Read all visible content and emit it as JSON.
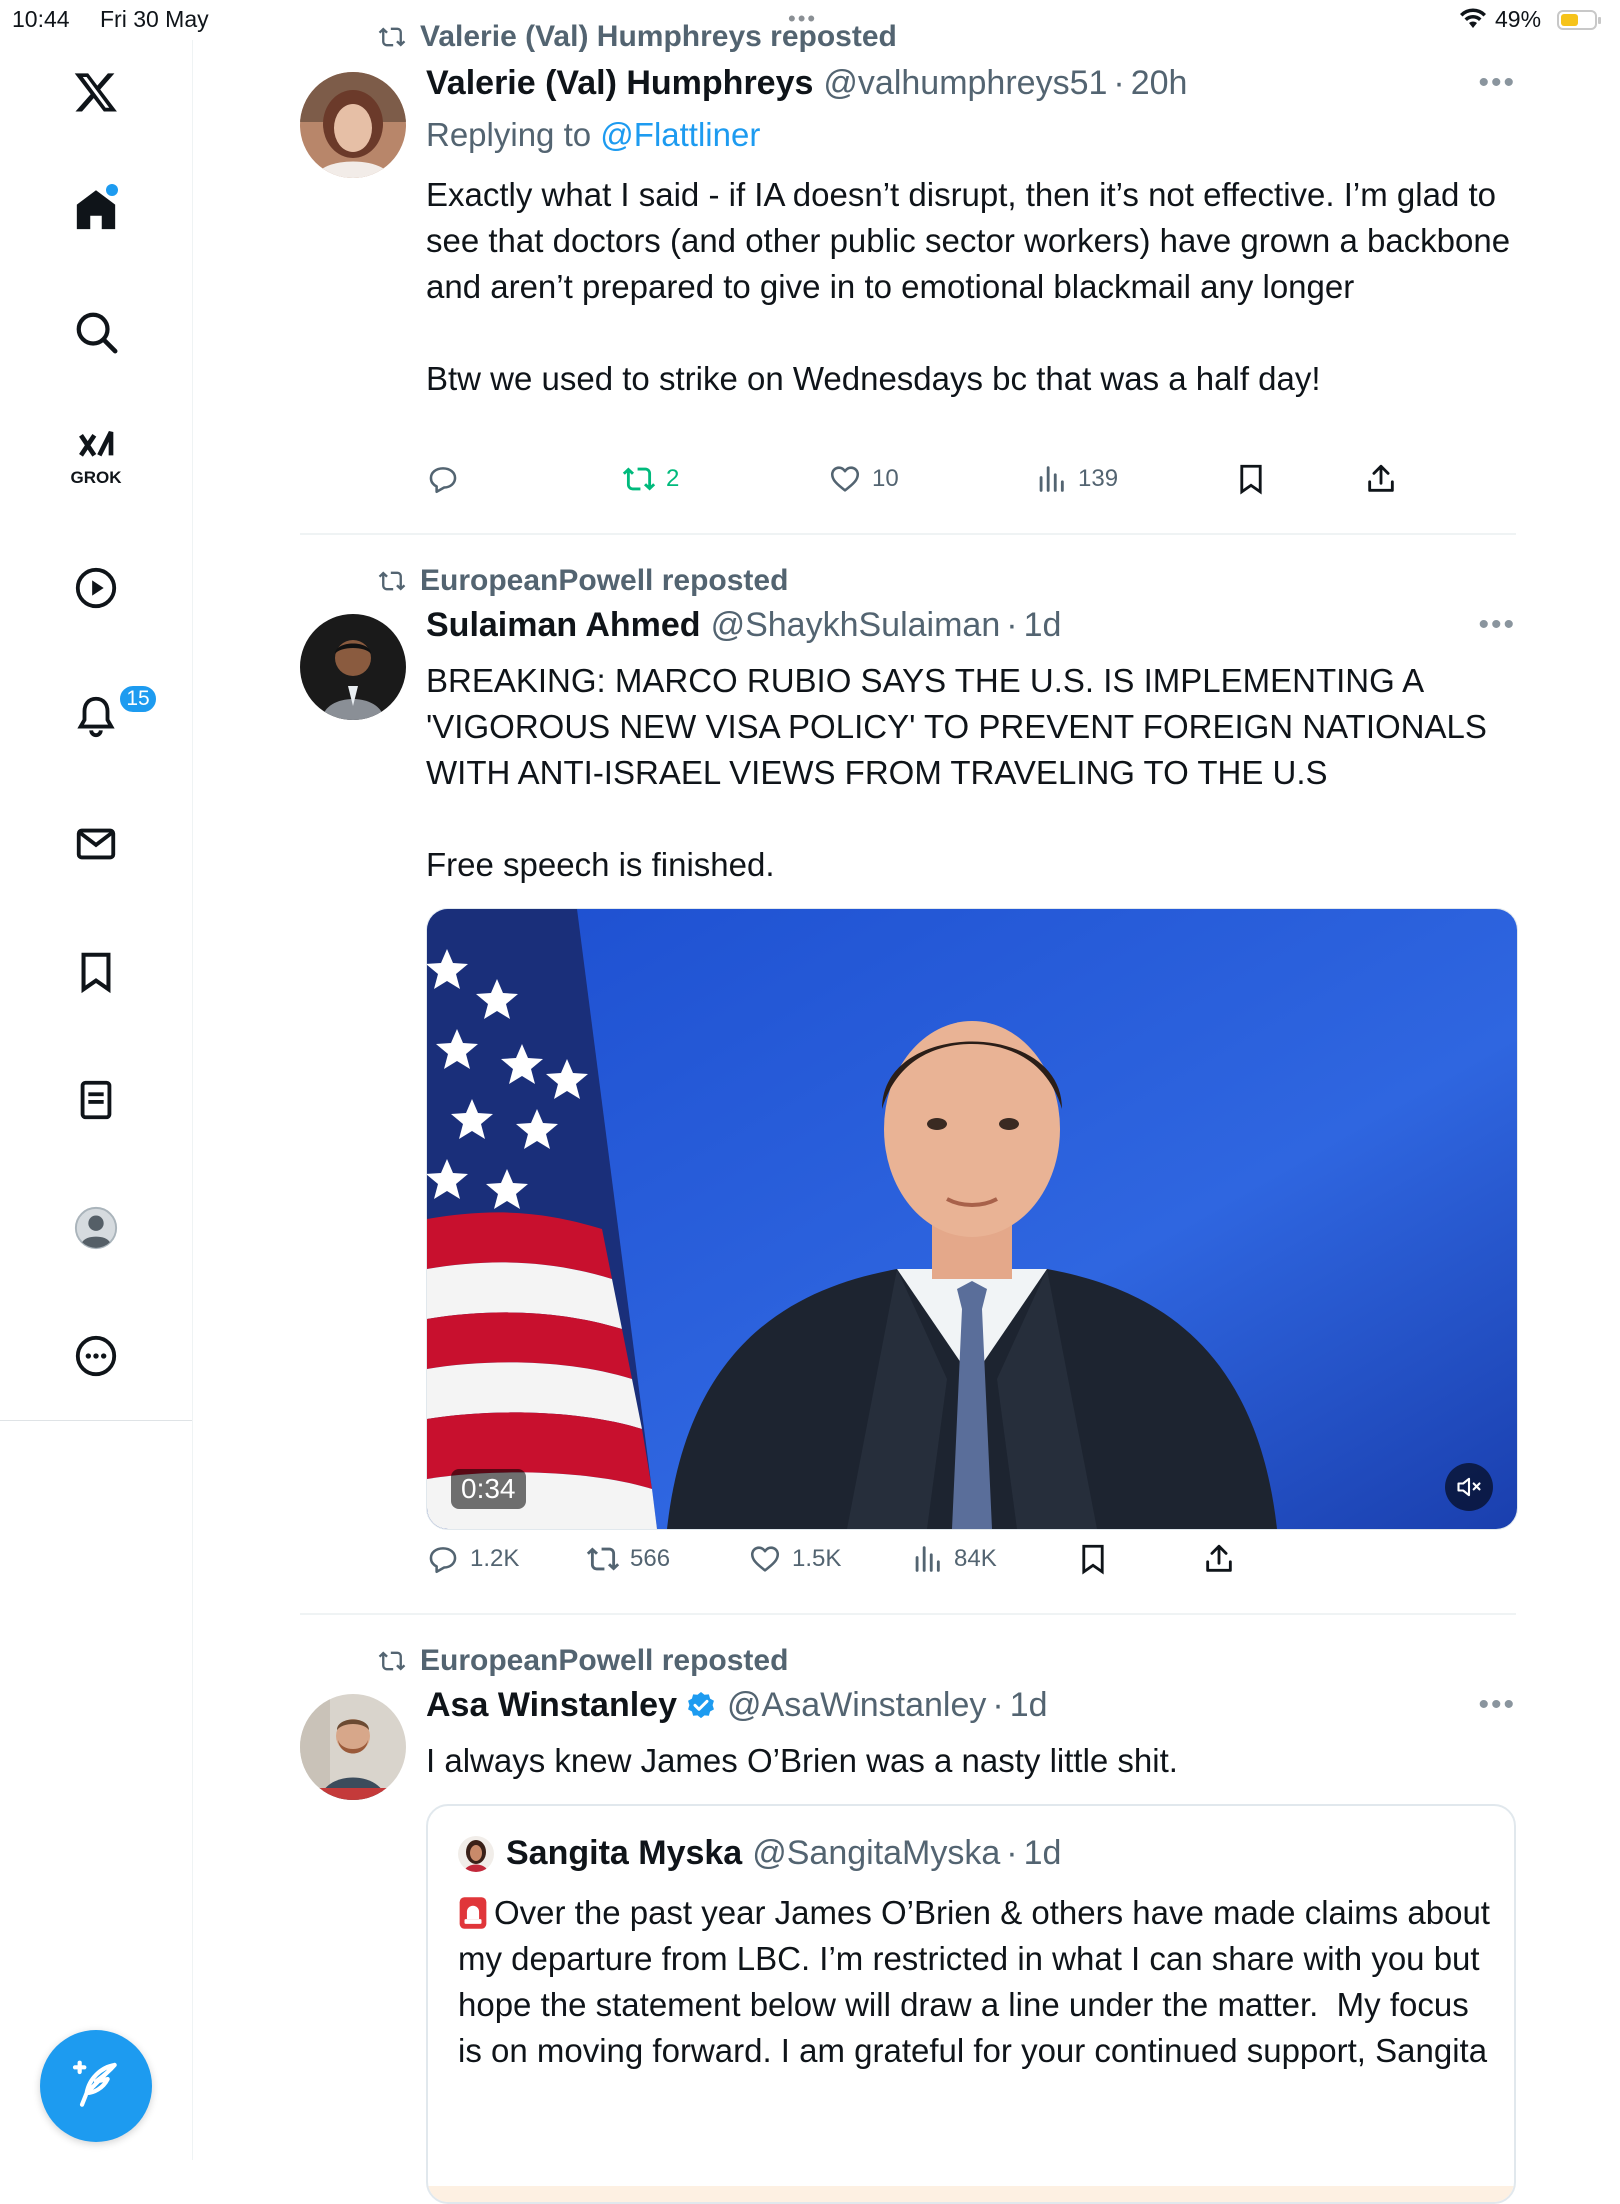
{
  "status_bar": {
    "time": "10:44",
    "date": "Fri 30 May",
    "battery_pct": "49%",
    "battery_level": 0.49,
    "battery_color": "#f6c31a"
  },
  "sidebar": {
    "notifications_badge": "15",
    "grok_label": "GROK",
    "items": [
      "x-logo-icon",
      "home-icon",
      "search-icon",
      "grok-icon",
      "video-icon",
      "notifications-icon",
      "messages-icon",
      "bookmarks-icon",
      "lists-icon",
      "profile-icon",
      "more-icon"
    ]
  },
  "compose_button": {
    "icon": "compose-feather-icon"
  },
  "colors": {
    "accent": "#1d9bf0",
    "repost_green": "#00ba7c",
    "muted": "#536471"
  },
  "posts": [
    {
      "repost_by": "Valerie (Val) Humphreys reposted",
      "name": "Valerie (Val) Humphreys",
      "handle": "@valhumphreys51",
      "time": "20h",
      "replying_prefix": "Replying to",
      "replying_to": "@Flattliner",
      "text": "Exactly what I said - if IA doesn’t disrupt, then it’s not effective. I’m glad to see that doctors (and other public sector workers) have grown a backbone and aren’t prepared to give in to emotional blackmail any longer\n\nBtw we used to strike on Wednesdays bc that was a half day!",
      "replies": "",
      "reposts": "2",
      "likes": "10",
      "views": "139"
    },
    {
      "repost_by": "EuropeanPowell reposted",
      "name": "Sulaiman Ahmed",
      "handle": "@ShaykhSulaiman",
      "time": "1d",
      "text": "BREAKING: MARCO RUBIO SAYS THE U.S. IS IMPLEMENTING A 'VIGOROUS NEW VISA POLICY' TO PREVENT FOREIGN NATIONALS WITH ANTI-ISRAEL VIEWS FROM TRAVELING TO THE U.S\n\nFree speech is finished.",
      "video_duration": "0:34",
      "replies": "1.2K",
      "reposts": "566",
      "likes": "1.5K",
      "views": "84K"
    },
    {
      "repost_by": "EuropeanPowell reposted",
      "name": "Asa Winstanley",
      "verified": true,
      "handle": "@AsaWinstanley",
      "time": "1d",
      "text": "I always knew James O’Brien was a nasty little shit.",
      "quote": {
        "name": "Sangita Myska",
        "handle": "@SangitaMyska",
        "time": "1d",
        "text": "Over the past year James O’Brien & others have made claims about my departure from LBC. I’m restricted in what I can share with you but hope the statement below will draw a line under the matter.  My focus is on moving forward. I am grateful for your continued support, Sangita"
      }
    }
  ]
}
